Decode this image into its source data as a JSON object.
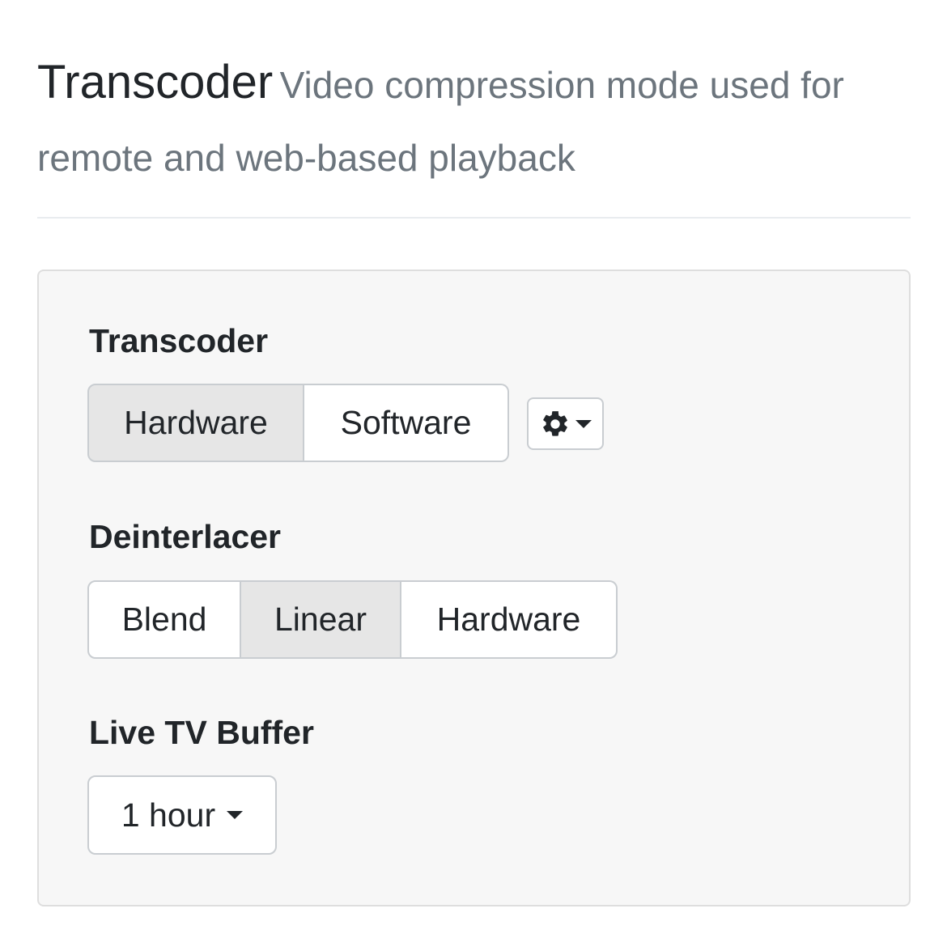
{
  "header": {
    "title": "Transcoder",
    "subtitle": "Video compression mode used for remote and web-based playback"
  },
  "transcoder": {
    "label": "Transcoder",
    "options": [
      "Hardware",
      "Software"
    ],
    "selected": "Hardware",
    "settings_icon": "gear-icon"
  },
  "deinterlacer": {
    "label": "Deinterlacer",
    "options": [
      "Blend",
      "Linear",
      "Hardware"
    ],
    "selected": "Linear"
  },
  "live_tv_buffer": {
    "label": "Live TV Buffer",
    "value": "1 hour"
  },
  "colors": {
    "active_button_bg": "#e6e6e6",
    "panel_bg": "#f7f7f7",
    "subtitle_text": "#6c757d"
  }
}
